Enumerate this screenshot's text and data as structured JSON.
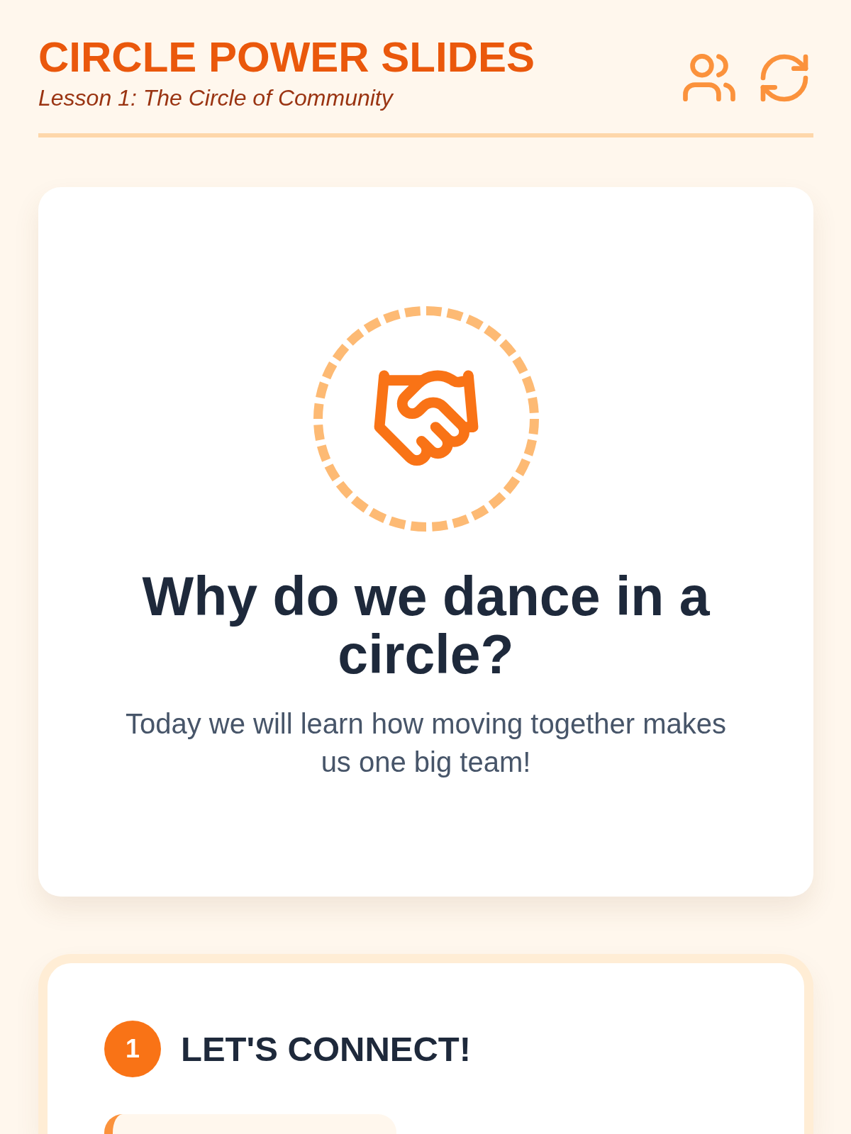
{
  "header": {
    "title": "CIRCLE POWER SLIDES",
    "subtitle": "Lesson 1: The Circle of Community"
  },
  "slides": [
    {
      "kind": "intro",
      "heading": "Why do we dance in a circle?",
      "text": "Today we will learn how moving together makes us one big team!"
    },
    {
      "kind": "step",
      "number": "1",
      "heading": "LET'S CONNECT!"
    }
  ]
}
